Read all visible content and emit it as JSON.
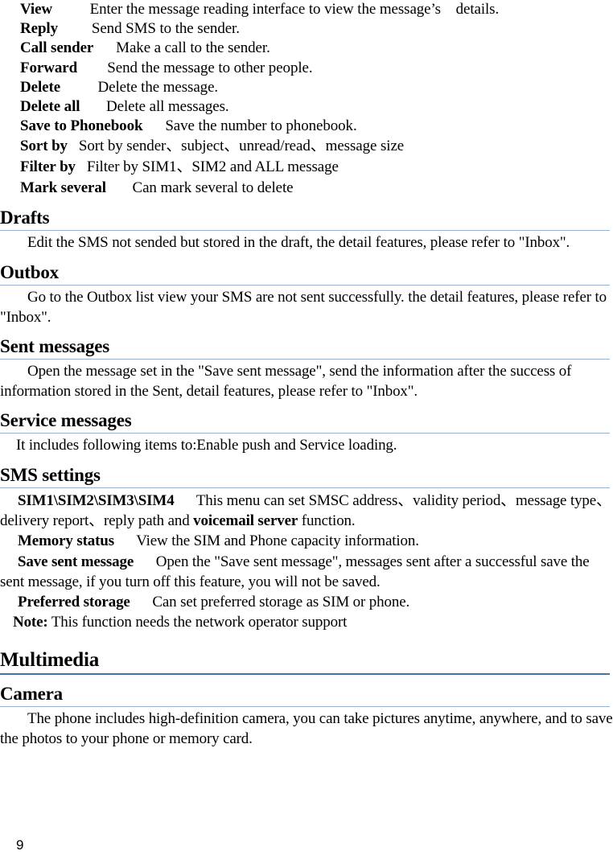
{
  "document": {
    "page_number": "9",
    "colors": {
      "major_rule": "#4472a8",
      "section_rule": "#9bb2d4",
      "text": "#000000",
      "background": "#ffffff"
    }
  },
  "inbox_options": {
    "items": [
      {
        "term": "View",
        "gap": "          ",
        "desc": "Enter the message reading interface to view the message’s    details."
      },
      {
        "term": "Reply",
        "gap": "         ",
        "desc": "Send SMS to the sender."
      },
      {
        "term": "Call sender",
        "gap": "      ",
        "desc": "Make a call to the sender."
      },
      {
        "term": "Forward",
        "gap": "        ",
        "desc": "Send the message to other people."
      },
      {
        "term": "Delete",
        "gap": "          ",
        "desc": "Delete the message."
      },
      {
        "term": "Delete all",
        "gap": "       ",
        "desc": "Delete all messages."
      },
      {
        "term": "Save to Phonebook",
        "gap": "      ",
        "desc": "Save the number to phonebook."
      },
      {
        "term": "Sort by",
        "gap": "   ",
        "desc": "Sort by sender、subject、unread/read、message size"
      },
      {
        "term": "Filter by",
        "gap": "   ",
        "desc": "Filter by SIM1、SIM2 and ALL message"
      },
      {
        "term": "Mark several",
        "gap": "       ",
        "desc": "Can mark several to delete"
      }
    ]
  },
  "sections": {
    "drafts": {
      "heading": "Drafts",
      "body": "Edit the SMS not sended but stored in the draft, the detail features, please refer to \"Inbox\"."
    },
    "outbox": {
      "heading": "Outbox",
      "body": "Go to the Outbox list view your SMS are not sent successfully. the detail features, please refer to \"Inbox\"."
    },
    "sent_messages": {
      "heading": "Sent messages",
      "body": "Open the message set in the \"Save sent message\", send the information after the success of information stored in the Sent, detail features, please refer to \"Inbox\"."
    },
    "service_messages": {
      "heading": "Service messages",
      "body": "It includes following items to:Enable push and Service loading."
    },
    "sms_settings": {
      "heading": "SMS settings",
      "sim": {
        "term": "SIM1\\SIM2\\SIM3\\SIM4",
        "gap": "      ",
        "desc_part1": "This menu can set SMSC address、validity period、message type、delivery report、reply path and ",
        "desc_bold": "voicemail server",
        "desc_part2": " function."
      },
      "memory_status": {
        "term": "Memory status",
        "gap": "      ",
        "desc": "View the SIM and Phone capacity information."
      },
      "save_sent_message": {
        "term": "Save sent message",
        "gap": "      ",
        "desc": "Open the \"Save sent message\", messages sent after a successful save the sent message, if you turn off this feature, you will not be saved."
      },
      "preferred_storage": {
        "term": "Preferred storage",
        "gap": "      ",
        "desc": "Can set preferred storage as SIM or phone."
      },
      "note": {
        "term": "Note:",
        "gap": " ",
        "desc": "This function needs the network operator support"
      }
    },
    "multimedia": {
      "heading": "Multimedia"
    },
    "camera": {
      "heading": "Camera",
      "body": "The phone includes high-definition camera, you can take pictures anytime, anywhere, and to save the photos to your phone or memory card."
    }
  }
}
